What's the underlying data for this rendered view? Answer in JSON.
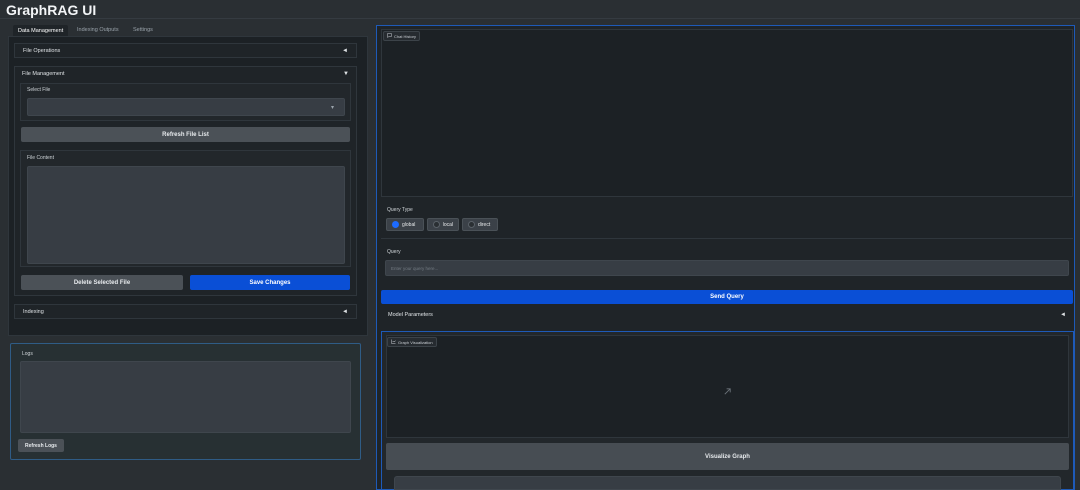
{
  "app": {
    "title": "GraphRAG UI"
  },
  "tabs": [
    "Data Management",
    "Indexing Outputs",
    "Settings"
  ],
  "left": {
    "file_operations": "File Operations",
    "file_management": "File Management",
    "select_file_label": "Select File",
    "refresh_file_list": "Refresh File List",
    "file_content_label": "File Content",
    "delete_selected_file": "Delete Selected File",
    "save_changes": "Save Changes",
    "indexing": "Indexing",
    "logs_label": "Logs",
    "refresh_logs": "Refresh Logs"
  },
  "right": {
    "chat_history": "Chat History",
    "query_type_label": "Query Type",
    "query_types": [
      "global",
      "local",
      "direct"
    ],
    "selected_query_type": "global",
    "query_label": "Query",
    "query_placeholder": "Enter your query here...",
    "send_query": "Send Query",
    "model_parameters": "Model Parameters",
    "graph_visualization": "Graph Visualization",
    "visualize_graph": "Visualize Graph"
  },
  "icons": {
    "caret_collapsed": "◄",
    "caret_expanded": "▼",
    "dropdown": "▾",
    "chat_icon": "chat-bubble-icon",
    "graph_icon": "chart-icon",
    "placeholder_image": "image-placeholder-icon"
  },
  "colors": {
    "background": "#2a2f33",
    "panel": "#1f2428",
    "primary_button": "#0a4fd6",
    "secondary_button": "#4b5157",
    "focus_outline": "#1e5ab8"
  }
}
